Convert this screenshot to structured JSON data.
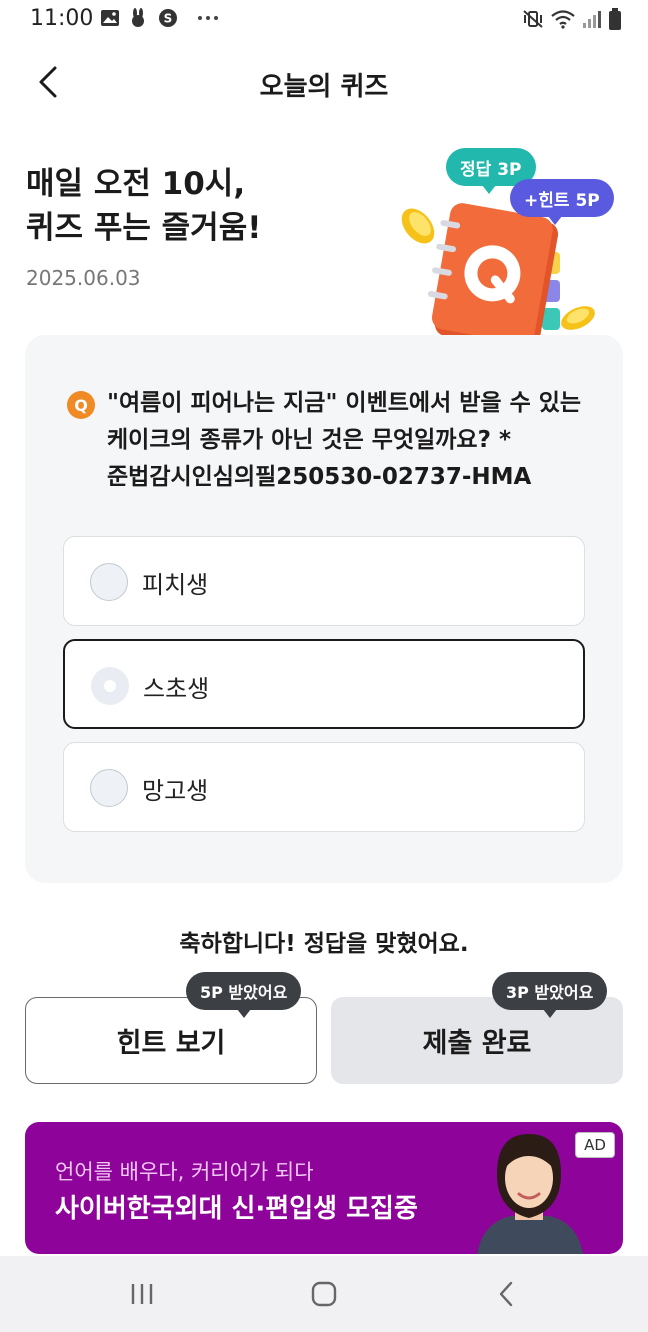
{
  "status_bar": {
    "time": "11:00",
    "left_icons": [
      "gallery-icon",
      "rabbit-icon",
      "s-badge-icon",
      "more-dots-icon"
    ],
    "right_icons": [
      "mute-vibrate-icon",
      "wifi-icon",
      "signal-icon",
      "battery-icon"
    ]
  },
  "header": {
    "title": "오늘의 퀴즈",
    "back_icon": "chevron-left-icon"
  },
  "hero": {
    "title_line1": "매일 오전 10시,",
    "title_line2": "퀴즈 푸는 즐거움!",
    "date": "2025.06.03",
    "bubble_answer": "정답 3P",
    "bubble_hint": "+힌트 5P",
    "illustration_letter": "Q"
  },
  "quiz": {
    "badge": "Q",
    "question": "\"여름이 피어나는 지금\" 이벤트에서 받을 수 있는 케이크의 종류가 아닌 것은 무엇일까요? *준법감시인심의필250530-02737-HMA",
    "options": [
      {
        "label": "피치생",
        "selected": false
      },
      {
        "label": "스초생",
        "selected": true
      },
      {
        "label": "망고생",
        "selected": false
      }
    ]
  },
  "result": {
    "message": "축하합니다! 정답을 맞혔어요.",
    "hint_button": "힌트 보기",
    "hint_tooltip": "5P 받았어요",
    "submit_button": "제출 완료",
    "submit_tooltip": "3P 받았어요"
  },
  "ad": {
    "subtitle": "언어를 배우다, 커리어가 되다",
    "title": "사이버한국외대 신·편입생 모집중",
    "badge": "AD",
    "background": "#8e0399"
  },
  "colors": {
    "accent_teal": "#23b8ad",
    "accent_purple": "#5a5ae0",
    "q_badge": "#f08a24",
    "notebook": "#f26b3a"
  }
}
